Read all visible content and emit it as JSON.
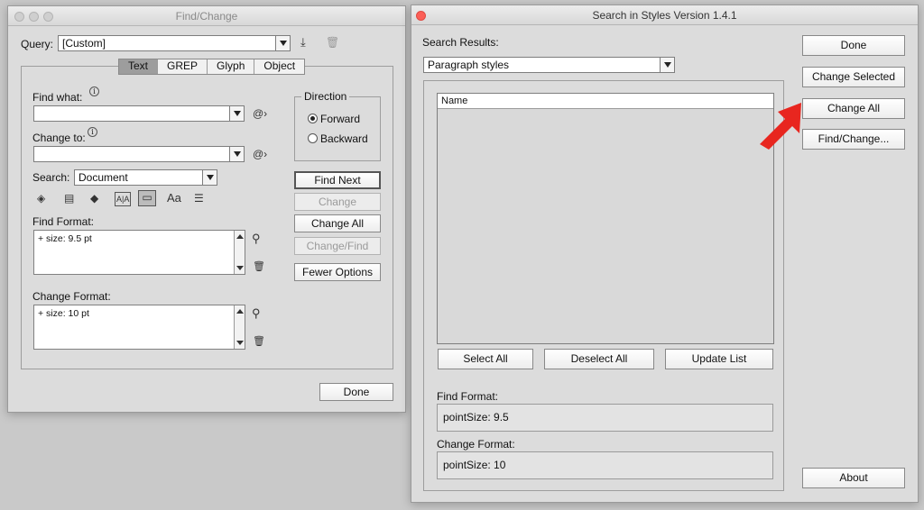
{
  "find_change": {
    "title": "Find/Change",
    "query_label": "Query:",
    "query_value": "[Custom]",
    "tabs": [
      {
        "label": "Text",
        "selected": true
      },
      {
        "label": "GREP",
        "selected": false
      },
      {
        "label": "Glyph",
        "selected": false
      },
      {
        "label": "Object",
        "selected": false
      }
    ],
    "find_what_label": "Find what:",
    "find_what_value": "",
    "change_to_label": "Change to:",
    "change_to_value": "",
    "search_label": "Search:",
    "search_value": "Document",
    "direction_label": "Direction",
    "forward_label": "Forward",
    "backward_label": "Backward",
    "direction_selected": "Forward",
    "find_format_label": "Find Format:",
    "find_format_value": "+ size: 9.5 pt",
    "change_format_label": "Change Format:",
    "change_format_value": "+ size: 10 pt",
    "buttons": {
      "find_next": "Find Next",
      "change": "Change",
      "change_all": "Change All",
      "change_find": "Change/Find",
      "fewer_options": "Fewer Options",
      "done": "Done"
    },
    "option_icons": [
      "include-locked-layers-icon",
      "include-locked-stories-icon",
      "include-hidden-layers-icon",
      "include-master-pages-icon",
      "include-footnotes-icon",
      "case-sensitive-icon",
      "whole-word-icon"
    ],
    "case_sensitive_glyph": "Aa"
  },
  "search_styles": {
    "title": "Search in Styles Version 1.4.1",
    "search_results_label": "Search Results:",
    "results_type": "Paragraph styles",
    "list_header": "Name",
    "buttons": {
      "done": "Done",
      "change_selected": "Change Selected",
      "change_all": "Change All",
      "find_change": "Find/Change...",
      "select_all": "Select All",
      "deselect_all": "Deselect All",
      "update_list": "Update List",
      "about": "About"
    },
    "find_format_label": "Find Format:",
    "find_format_value": "pointSize: 9.5",
    "change_format_label": "Change Format:",
    "change_format_value": "pointSize: 10"
  },
  "annotation": {
    "arrow_color": "#e8261f"
  }
}
